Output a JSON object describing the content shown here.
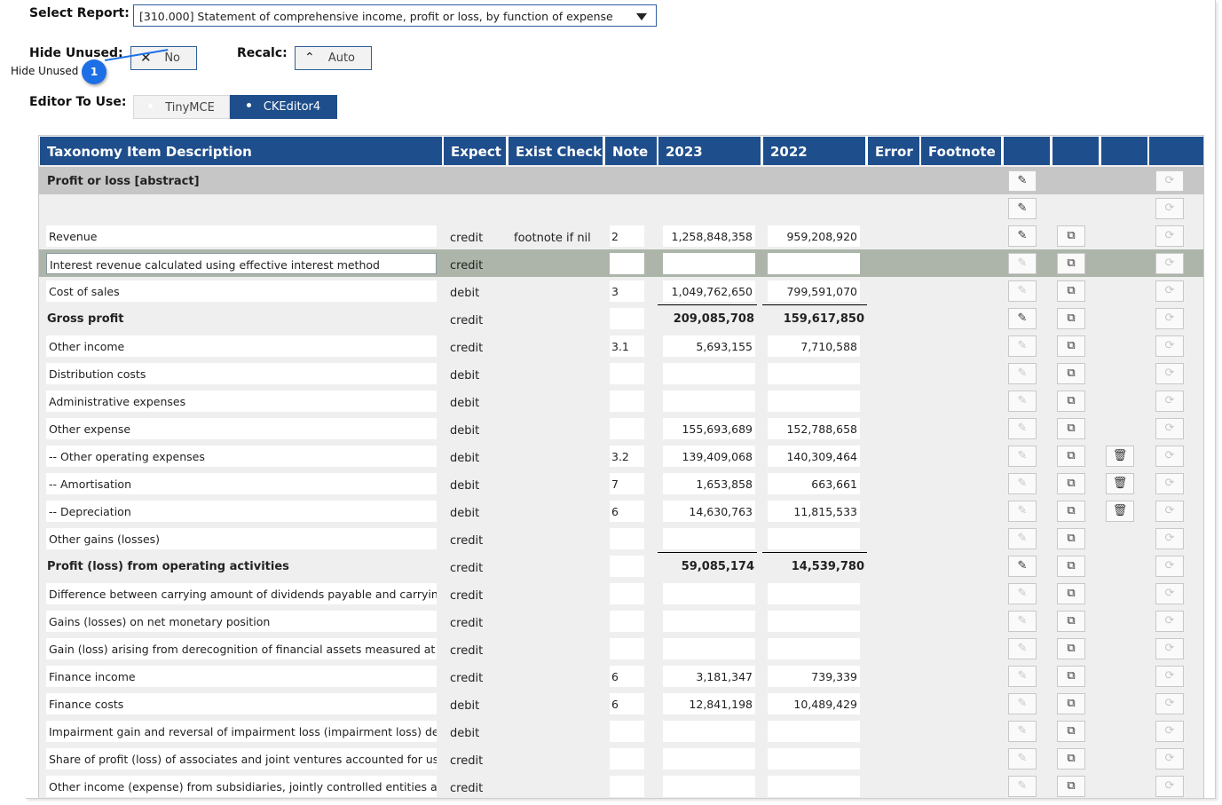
{
  "controls": {
    "select_report_label": "Select Report:",
    "select_report_value": "[310.000] Statement of comprehensive income, profit or loss, by function of expense",
    "hide_unused_label": "Hide Unused:",
    "hide_unused_value": "No",
    "recalc_label": "Recalc:",
    "recalc_value": "Auto",
    "editor_label": "Editor To Use:",
    "editor_options": [
      "TinyMCE",
      "CKEditor4"
    ],
    "editor_selected": "CKEditor4"
  },
  "callout": {
    "number": "1",
    "text": "Hide Unused"
  },
  "columns": [
    "Taxonomy Item Description",
    "Expect",
    "Exist Check",
    "Note",
    "2023",
    "2022",
    "Error",
    "Footnote",
    "",
    "",
    "",
    ""
  ],
  "rows": [
    {
      "kind": "abstract",
      "desc": "Profit or loss [abstract]",
      "expect": "",
      "exist": "",
      "note": "",
      "v2023": "",
      "v2022": "",
      "edit": "active",
      "copy": false,
      "del": false
    },
    {
      "kind": "blank",
      "desc": "",
      "expect": "",
      "exist": "",
      "note": "",
      "v2023": "",
      "v2022": "",
      "edit": "active",
      "copy": false,
      "del": false
    },
    {
      "kind": "item",
      "desc": "Revenue",
      "expect": "credit",
      "exist": "footnote if nil",
      "note": "2",
      "v2023": "1,258,848,358",
      "v2022": "959,208,920",
      "edit": "active",
      "copy": true,
      "del": false
    },
    {
      "kind": "item",
      "selected": true,
      "desc": "Interest revenue calculated using effective interest method",
      "expect": "credit",
      "exist": "",
      "note": "",
      "v2023": "",
      "v2022": "",
      "edit": "dim",
      "copy": true,
      "del": false
    },
    {
      "kind": "item",
      "desc": "Cost of sales",
      "expect": "debit",
      "exist": "",
      "note": "3",
      "v2023": "1,049,762,650",
      "v2022": "799,591,070",
      "edit": "dim",
      "copy": true,
      "del": false
    },
    {
      "kind": "total",
      "desc": "Gross profit",
      "expect": "credit",
      "exist": "",
      "note": "",
      "v2023": "209,085,708",
      "v2022": "159,617,850",
      "edit": "active",
      "copy": true,
      "del": false
    },
    {
      "kind": "item",
      "desc": "Other income",
      "expect": "credit",
      "exist": "",
      "note": "3.1",
      "v2023": "5,693,155",
      "v2022": "7,710,588",
      "edit": "dim",
      "copy": true,
      "del": false
    },
    {
      "kind": "item",
      "desc": "Distribution costs",
      "expect": "debit",
      "exist": "",
      "note": "",
      "v2023": "",
      "v2022": "",
      "edit": "dim",
      "copy": true,
      "del": false
    },
    {
      "kind": "item",
      "desc": "Administrative expenses",
      "expect": "debit",
      "exist": "",
      "note": "",
      "v2023": "",
      "v2022": "",
      "edit": "dim",
      "copy": true,
      "del": false
    },
    {
      "kind": "item",
      "desc": "Other expense",
      "expect": "debit",
      "exist": "",
      "note": "",
      "v2023": "155,693,689",
      "v2022": "152,788,658",
      "edit": "dim",
      "copy": true,
      "del": false
    },
    {
      "kind": "item",
      "desc": "-- Other operating expenses",
      "expect": "debit",
      "exist": "",
      "note": "3.2",
      "v2023": "139,409,068",
      "v2022": "140,309,464",
      "edit": "dim",
      "copy": true,
      "del": true
    },
    {
      "kind": "item",
      "desc": "-- Amortisation",
      "expect": "debit",
      "exist": "",
      "note": "7",
      "v2023": "1,653,858",
      "v2022": "663,661",
      "edit": "dim",
      "copy": true,
      "del": true
    },
    {
      "kind": "item",
      "desc": "-- Depreciation",
      "expect": "debit",
      "exist": "",
      "note": "6",
      "v2023": "14,630,763",
      "v2022": "11,815,533",
      "edit": "dim",
      "copy": true,
      "del": true
    },
    {
      "kind": "item",
      "desc": "Other gains (losses)",
      "expect": "credit",
      "exist": "",
      "note": "",
      "v2023": "",
      "v2022": "",
      "edit": "dim",
      "copy": true,
      "del": false
    },
    {
      "kind": "total",
      "desc": "Profit (loss) from operating activities",
      "expect": "credit",
      "exist": "",
      "note": "",
      "v2023": "59,085,174",
      "v2022": "14,539,780",
      "edit": "active",
      "copy": true,
      "del": false
    },
    {
      "kind": "item",
      "desc": "Difference between carrying amount of dividends payable and carrying amount",
      "expect": "credit",
      "exist": "",
      "note": "",
      "v2023": "",
      "v2022": "",
      "edit": "dim",
      "copy": true,
      "del": false
    },
    {
      "kind": "item",
      "desc": "Gains (losses) on net monetary position",
      "expect": "credit",
      "exist": "",
      "note": "",
      "v2023": "",
      "v2022": "",
      "edit": "dim",
      "copy": true,
      "del": false
    },
    {
      "kind": "item",
      "desc": "Gain (loss) arising from derecognition of financial assets measured at amortised cost",
      "expect": "credit",
      "exist": "",
      "note": "",
      "v2023": "",
      "v2022": "",
      "edit": "dim",
      "copy": true,
      "del": false
    },
    {
      "kind": "item",
      "desc": "Finance income",
      "expect": "credit",
      "exist": "",
      "note": "6",
      "v2023": "3,181,347",
      "v2022": "739,339",
      "edit": "dim",
      "copy": true,
      "del": false
    },
    {
      "kind": "item",
      "desc": "Finance costs",
      "expect": "debit",
      "exist": "",
      "note": "6",
      "v2023": "12,841,198",
      "v2022": "10,489,429",
      "edit": "dim",
      "copy": true,
      "del": false
    },
    {
      "kind": "item",
      "desc": "Impairment gain and reversal of impairment loss (impairment loss) determined",
      "expect": "debit",
      "exist": "",
      "note": "",
      "v2023": "",
      "v2022": "",
      "edit": "dim",
      "copy": true,
      "del": false
    },
    {
      "kind": "item",
      "desc": "Share of profit (loss) of associates and joint ventures accounted for using equity",
      "expect": "credit",
      "exist": "",
      "note": "",
      "v2023": "",
      "v2022": "",
      "edit": "dim",
      "copy": true,
      "del": false
    },
    {
      "kind": "item",
      "desc": "Other income (expense) from subsidiaries, jointly controlled entities and associates",
      "expect": "credit",
      "exist": "",
      "note": "",
      "v2023": "",
      "v2022": "",
      "edit": "dim",
      "copy": true,
      "del": false
    }
  ]
}
